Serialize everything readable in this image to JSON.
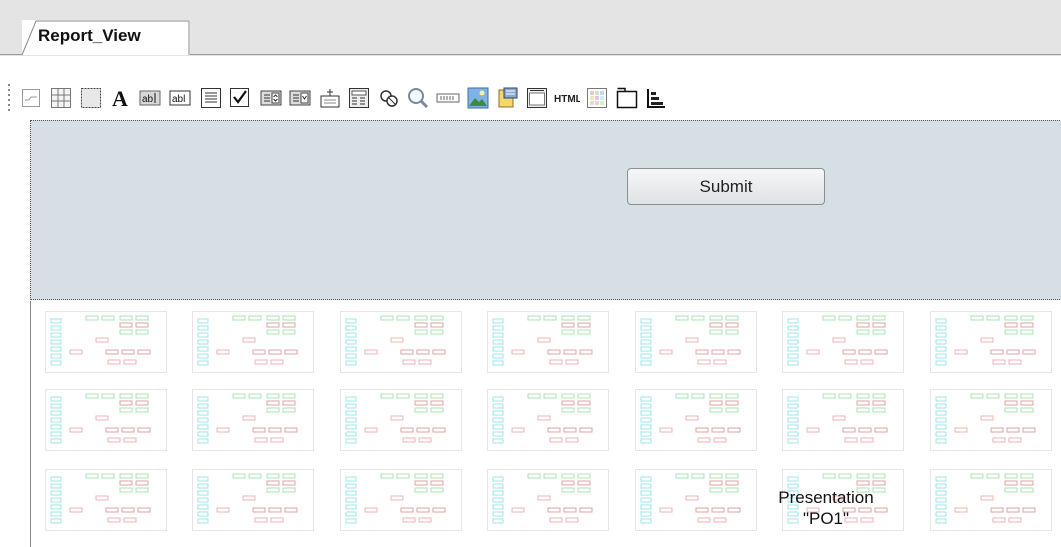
{
  "tab": {
    "label": "Report_View"
  },
  "toolbar": {
    "buttons": [
      "sparkline-icon",
      "table-icon",
      "rectangle-icon",
      "label-text-icon",
      "textbox-icon",
      "input-textbox-icon",
      "memo-icon",
      "checkbox-icon",
      "listbox-icon",
      "combobox-icon",
      "date-picker-icon",
      "calculator-icon",
      "link-icon",
      "search-icon",
      "progress-icon",
      "image-icon",
      "database-icon",
      "calendar-icon",
      "html-icon",
      "color-picker-icon",
      "panel-icon",
      "bar-chart-icon"
    ],
    "html_text": "HTML"
  },
  "form": {
    "submit_label": "Submit"
  },
  "presentation": {
    "label_line1": "Presentation",
    "label_line2": "\"PO1\""
  },
  "colors": {
    "band": "#d6dfe3",
    "thumb_cyan": "#9fe5ea",
    "thumb_green": "#a9e3b3",
    "thumb_pink": "#efb3b3",
    "thumb_red": "#e2a3a3"
  }
}
